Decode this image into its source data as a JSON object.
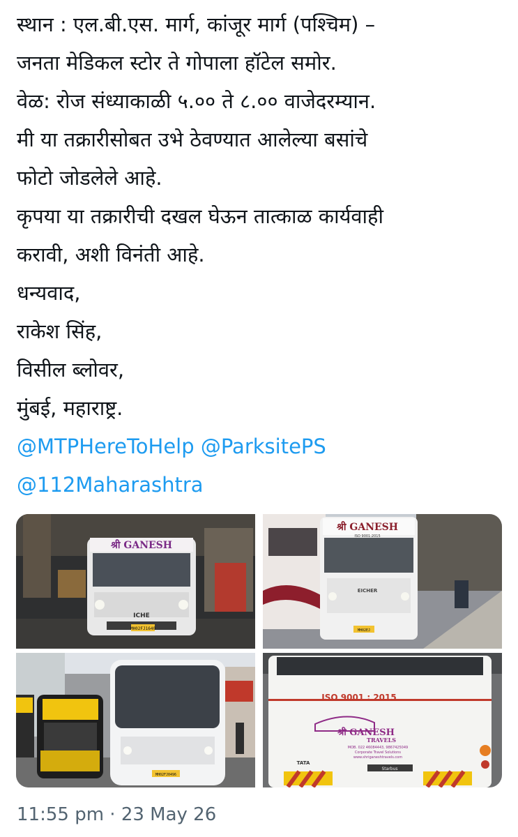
{
  "tweet": {
    "lines": [
      "स्थान : एल.बी.एस. मार्ग, कांजूर मार्ग (पश्चिम) –",
      "जनता मेडिकल स्टोर ते गोपाला हॉटेल समोर.",
      "वेळ: रोज संध्याकाळी ५.०० ते ८.०० वाजेदरम्यान.",
      "मी या तक्रारीसोबत उभे ठेवण्यात आलेल्या बसांचे",
      "फोटो जोडलेले आहे.",
      "कृपया या तक्रारीची दखल घेऊन तात्काळ कार्यवाही",
      "करावी, अशी विनंती आहे.",
      "धन्यवाद,",
      "राकेश सिंह,",
      "विसील ब्लोवर,",
      "मुंबई, महाराष्ट्र."
    ],
    "mentions": {
      "m1": "@MTPHereToHelp",
      "m2": "@ParksitePS",
      "m3": "@112Maharashtra"
    },
    "timestamp": "11:55 pm · 23 May 26"
  },
  "photos": {
    "p1": {
      "sign": "श्री GANESH",
      "plate": "MH02FJ1640",
      "brand": "ICHE"
    },
    "p2": {
      "sign": "श्री GANESH",
      "sub": "ISO 9001:2015",
      "plate": "MH02EJ",
      "brand": "EICHER"
    },
    "p3": {
      "plate": "MH02FJ0496"
    },
    "p4": {
      "iso": "ISO 9001 : 2015",
      "name": "श्री GANESH",
      "travels": "TRAVELS",
      "mob": "MOB. 022 46084443, 9867425049",
      "tagline": "Corporate Travel Solutions",
      "web": "www.shriganeshtravels.com",
      "brand": "TATA",
      "model": "Starbus"
    }
  }
}
